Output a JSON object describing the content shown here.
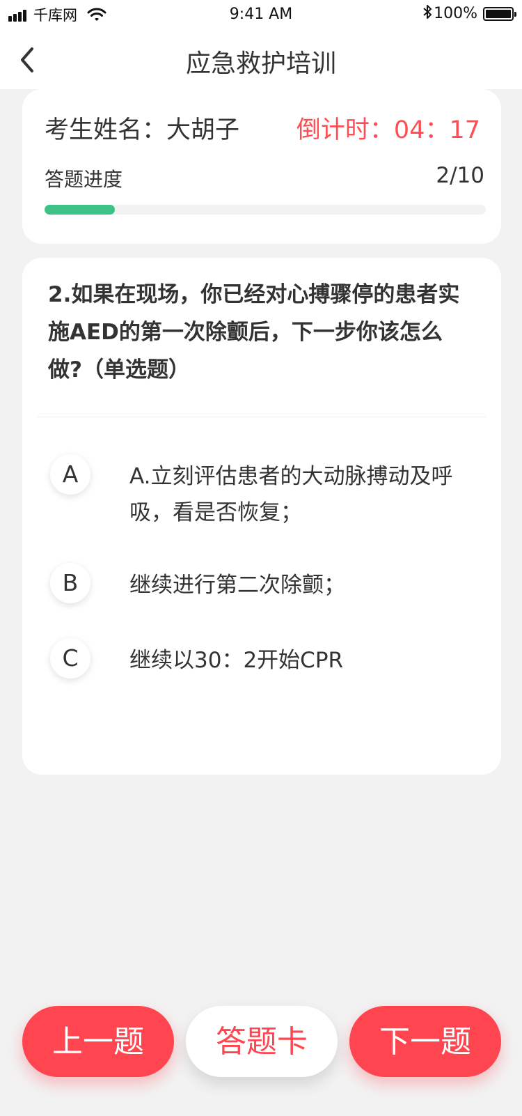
{
  "status_bar": {
    "carrier": "千库网",
    "time": "9:41 AM",
    "battery": "100%"
  },
  "nav": {
    "title": "应急救护培训"
  },
  "exam": {
    "name_label": "考生姓名：大胡子",
    "countdown": "倒计时：04：17",
    "progress_label": "答题进度",
    "progress_text": "2/10",
    "progress_fraction": 0.16
  },
  "question": {
    "text": "2.如果在现场，你已经对心搏骤停的患者实施AED的第一次除颤后，下一步你该怎么做?（单选题）",
    "options": [
      {
        "letter": "A",
        "text": "A.立刻评估患者的大动脉搏动及呼吸，看是否恢复；"
      },
      {
        "letter": "B",
        "text": "继续进行第二次除颤；"
      },
      {
        "letter": "C",
        "text": "继续以30：2开始CPR"
      }
    ]
  },
  "buttons": {
    "prev": "上一题",
    "card": "答题卡",
    "next": "下一题"
  },
  "colors": {
    "accent_red": "#ff4550",
    "progress_green": "#3ec186",
    "background": "#f2f2f2"
  }
}
